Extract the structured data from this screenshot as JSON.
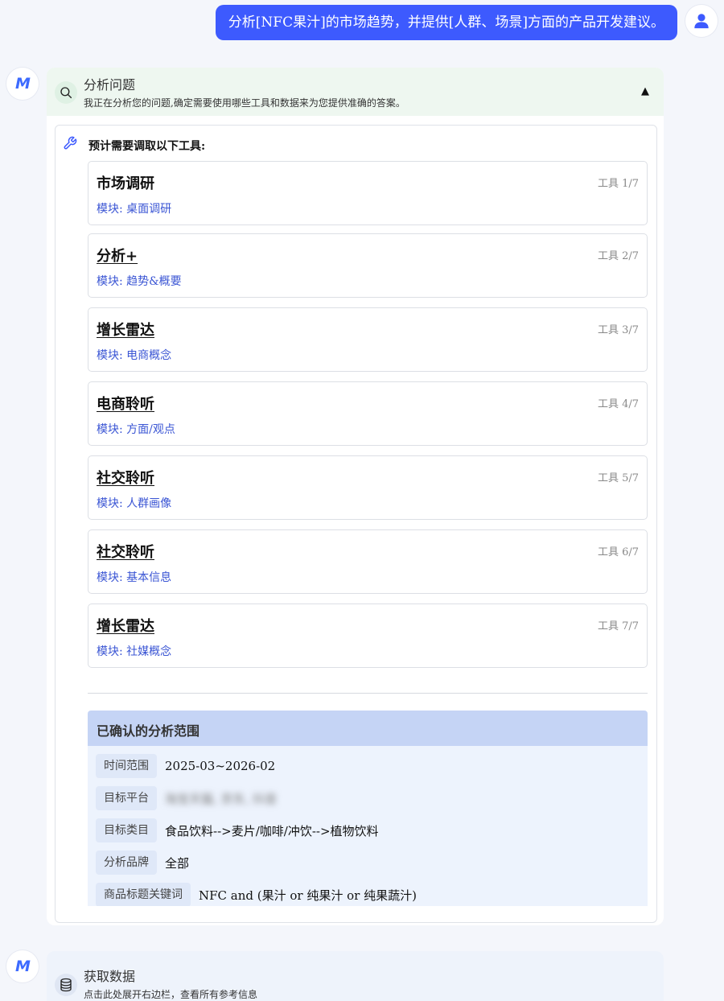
{
  "user_message": "分析[NFC果汁]的市场趋势，并提供[人群、场景]方面的产品开发建议。",
  "bot_logo_text": "M",
  "analysis": {
    "title": "分析问题",
    "subtitle": "我正在分析您的问题,确定需要使用哪些工具和数据来为您提供准确的答案。",
    "toggle": "▲",
    "tools_heading": "预计需要调取以下工具:",
    "tools": [
      {
        "name": "市场调研",
        "index": "工具 1/7",
        "module": "模块: 桌面调研"
      },
      {
        "name": "分析+",
        "index": "工具 2/7",
        "module": "模块: 趋势&概要"
      },
      {
        "name": "增长雷达",
        "index": "工具 3/7",
        "module": "模块: 电商概念"
      },
      {
        "name": "电商聆听",
        "index": "工具 4/7",
        "module": "模块: 方面/观点"
      },
      {
        "name": "社交聆听",
        "index": "工具 5/7",
        "module": "模块: 人群画像"
      },
      {
        "name": "社交聆听",
        "index": "工具 6/7",
        "module": "模块: 基本信息"
      },
      {
        "name": "增长雷达",
        "index": "工具 7/7",
        "module": "模块: 社媒概念"
      }
    ],
    "scope": {
      "title": "已确认的分析范围",
      "rows": [
        {
          "label": "时间范围",
          "value": "2025-03~2026-02"
        },
        {
          "label": "目标平台",
          "value": "淘宝天猫, 京东, 抖音"
        },
        {
          "label": "目标类目",
          "value": "食品饮料-->麦片/咖啡/冲饮-->植物饮料"
        },
        {
          "label": "分析品牌",
          "value": "全部"
        },
        {
          "label": "商品标题关键词",
          "value": "NFC and (果汁 or 纯果汁 or 纯果蔬汁)"
        }
      ]
    }
  },
  "fetch": {
    "title": "获取数据",
    "subtitle": "点击此处展开右边栏，查看所有参考信息"
  }
}
